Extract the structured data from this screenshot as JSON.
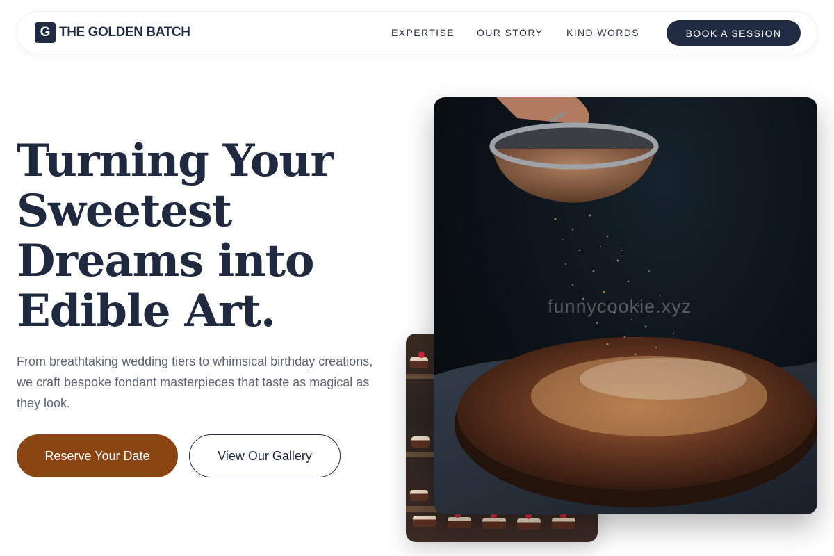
{
  "brand": {
    "mark": "G",
    "name": "THE GOLDEN BATCH"
  },
  "nav": {
    "links": [
      "EXPERTISE",
      "OUR STORY",
      "KIND WORDS"
    ],
    "cta": "BOOK A SESSION"
  },
  "hero": {
    "headline_lines": [
      "Turning Your",
      "Sweetest",
      "Dreams into",
      "Edible Art."
    ],
    "subtext": "From breathtaking wedding tiers to whimsical birthday creations, we craft bespoke fondant masterpieces that taste as magical as they look.",
    "primary_button": "Reserve Your Date",
    "secondary_button": "View Our Gallery"
  },
  "images": {
    "main_alt": "Cocoa powder sifted over a chocolate cake",
    "secondary_alt": "Display case of cakes and pastries",
    "watermark": "funnycookie.xyz"
  },
  "colors": {
    "navy": "#202b42",
    "accent_brown": "#8a4513",
    "body_text": "#5b6475"
  }
}
